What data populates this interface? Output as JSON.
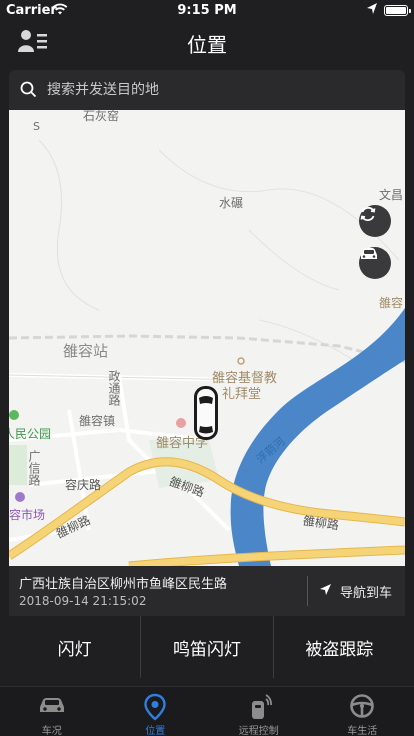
{
  "status": {
    "carrier": "Carrier",
    "time": "9:15 PM"
  },
  "nav": {
    "title": "位置"
  },
  "search": {
    "placeholder": "搜索并发送目的地"
  },
  "map": {
    "labels": {
      "shihui": "石灰窑",
      "shuinian": "水碾",
      "wenchang": "文昌",
      "yongrong_right": "雒容",
      "station": "雒容站",
      "church": "雒容基督教",
      "church2": "礼拜堂",
      "zhengtong": "政通路",
      "town": "雒容镇",
      "school": "雒容中学",
      "park": "人民公园",
      "guangxin": "广信路",
      "rongqing": "容庆路",
      "market": "容市场",
      "yongliu1": "雒柳路",
      "yongliu2": "雒柳路",
      "yongliu3": "雒柳路",
      "river": "浮箭河",
      "compass": "S"
    }
  },
  "info": {
    "address": "广西壮族自治区柳州市鱼峰区民生路",
    "timestamp": "2018-09-14 21:15:02",
    "navigate_label": "导航到车"
  },
  "actions": [
    "闪灯",
    "鸣笛闪灯",
    "被盗跟踪"
  ],
  "tabs": [
    {
      "label": "车况",
      "icon": "car-icon"
    },
    {
      "label": "位置",
      "icon": "location-pin-icon"
    },
    {
      "label": "远程控制",
      "icon": "remote-key-icon"
    },
    {
      "label": "车生活",
      "icon": "steering-wheel-icon"
    }
  ],
  "colors": {
    "accent": "#2e7fe0",
    "road": "#f2d070",
    "river": "#4a86c8",
    "background": "#1f1f21"
  }
}
